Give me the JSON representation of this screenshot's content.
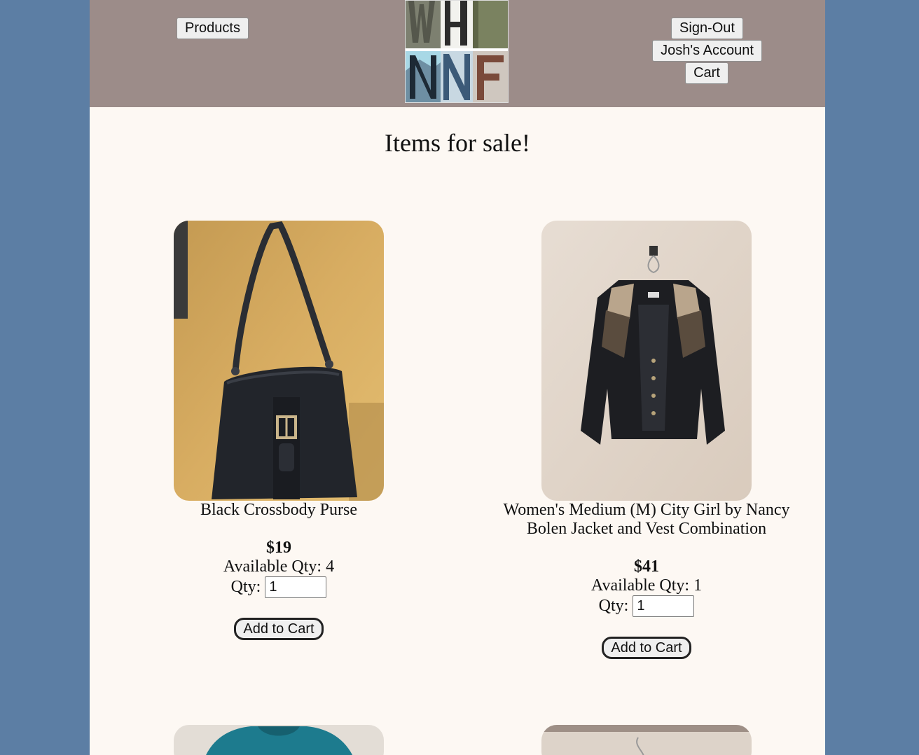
{
  "header": {
    "products_label": "Products",
    "signout_label": "Sign-Out",
    "account_label": "Josh's Account",
    "cart_label": "Cart",
    "logo_letters": "WHNF"
  },
  "main": {
    "title": "Items for sale!"
  },
  "products": [
    {
      "name": "Black Crossbody Purse",
      "price": "$19",
      "available": "Available Qty: 4",
      "qty_label": "Qty:",
      "qty_value": "1",
      "add_label": "Add to Cart"
    },
    {
      "name": "Women's Medium (M) City Girl by Nancy Bolen Jacket and Vest Combination",
      "price": "$41",
      "available": "Available Qty: 1",
      "qty_label": "Qty:",
      "qty_value": "1",
      "add_label": "Add to Cart"
    }
  ],
  "colors": {
    "outer_bg": "#5c7ea4",
    "header_bg": "#9c8c89",
    "page_bg": "#fdf8f3"
  }
}
